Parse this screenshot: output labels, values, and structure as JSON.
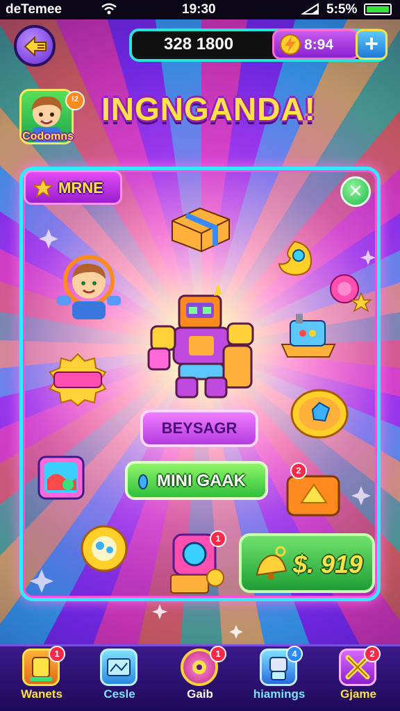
{
  "status_bar": {
    "carrier": "deTemee",
    "time": "19:30",
    "battery": "5:5%"
  },
  "header": {
    "coins": "328 1800",
    "gems": "8:94",
    "plus_label": "+"
  },
  "player": {
    "name": "Codomns",
    "level_badge": "!2"
  },
  "title": "INGNGANDA!",
  "panel": {
    "tab_label": "MRNE",
    "close_label": "✕",
    "purple_button": "BEYSAGR",
    "green_button": "MINI GAAK",
    "price": "$. 919",
    "item_badges": {
      "card": "2",
      "chest": "1"
    }
  },
  "nav": [
    {
      "label": "Wanets",
      "badge": "1",
      "color": "#ffe14a"
    },
    {
      "label": "Cesle",
      "badge": "",
      "color": "#7fe0ff"
    },
    {
      "label": "Gaib",
      "badge": "1",
      "color": "#ffffff"
    },
    {
      "label": "hiamings",
      "badge": "4",
      "color": "#7fe0ff"
    },
    {
      "label": "Gjame",
      "badge": "2",
      "color": "#ffe14a"
    }
  ],
  "colors": {
    "accent_cyan": "#35e8ff",
    "accent_pink": "#ff4fd8",
    "gold": "#ffe14a",
    "green": "#2fbf3a",
    "purple": "#9a1fd0"
  }
}
